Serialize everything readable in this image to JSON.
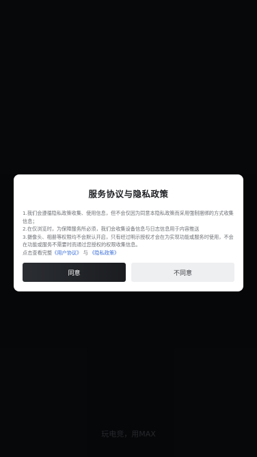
{
  "slogan": "玩电竞，用MAX",
  "dialog": {
    "title": "服务协议与隐私政策",
    "lines": [
      "1.我们会遵循隐私政策收集、使用信息，但不会仅因为同意本隐私政策而采用强制捆绑的方式收集信息；",
      "2.在仅浏览时，为保障服务所必须，我们会收集设备信息与日志信息用于内容推送",
      "3.摄像头、相册等权限均不会默认开启，只有经过明示授权才会在为实现功能或服务时使用，不会在功能或服务不需要时而通过您授权的权限收集信息。"
    ],
    "footer_prefix": "点击查看完整",
    "user_agreement_link": "《用户协议》",
    "footer_and": "与",
    "privacy_policy_link": "《隐私政策》",
    "agree_label": "同意",
    "disagree_label": "不同意"
  },
  "colors": {
    "link": "#3b6fd8",
    "agree_bg": "#2b2e33",
    "disagree_bg": "#eeeff1"
  }
}
